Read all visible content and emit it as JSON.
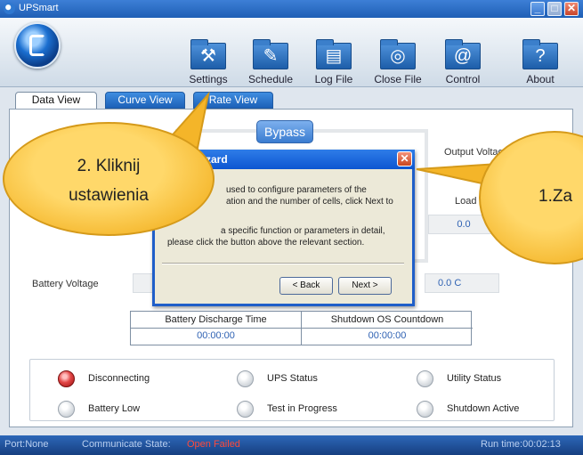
{
  "window": {
    "title": "UPSmart"
  },
  "toolbar": [
    {
      "label": "Settings",
      "icon": "hammer-icon",
      "glyph": "⚒"
    },
    {
      "label": "Schedule",
      "icon": "edit-icon",
      "glyph": "✎"
    },
    {
      "label": "Log File",
      "icon": "document-icon",
      "glyph": "▤"
    },
    {
      "label": "Close File",
      "icon": "disc-icon",
      "glyph": "◎"
    },
    {
      "label": "Control",
      "icon": "at-icon",
      "glyph": "@"
    },
    {
      "label": "About",
      "icon": "question-icon",
      "glyph": "?"
    }
  ],
  "tabs": [
    {
      "label": "Data View",
      "active": true
    },
    {
      "label": "Curve View",
      "active": false
    },
    {
      "label": "Rate View",
      "active": false
    }
  ],
  "main": {
    "bypass_label": "Bypass",
    "output_voltage_label": "Output Voltage",
    "load_label": "Load",
    "load_value": "0.0",
    "battery_voltage_label": "Battery Voltage",
    "temperature_value": "0.0 C",
    "battery_discharge_label": "Battery Discharge Time",
    "battery_discharge_value": "00:00:00",
    "shutdown_countdown_label": "Shutdown OS Countdown",
    "shutdown_countdown_value": "00:00:00"
  },
  "indicators": [
    {
      "label": "Disconnecting",
      "state": "red"
    },
    {
      "label": "UPS Status",
      "state": "off"
    },
    {
      "label": "Utility Status",
      "state": "off"
    },
    {
      "label": "Battery Low",
      "state": "off"
    },
    {
      "label": "Test in Progress",
      "state": "off"
    },
    {
      "label": "Shutdown Active",
      "state": "off"
    }
  ],
  "statusbar": {
    "port": "Port:None",
    "communicate_label": "Communicate State:",
    "communicate_value": "Open Failed",
    "run_time": "Run time:00:02:13"
  },
  "wizard": {
    "title": "zard",
    "line1": "used to configure parameters of the",
    "line2": "ation and the number of cells, click Next to",
    "line3": "a specific function or parameters in detail,",
    "line4": "please click the button above the relevant section.",
    "back_label": "< Back",
    "next_label": "Next >"
  },
  "callouts": {
    "left_line1": "2. Kliknij",
    "left_line2": "ustawienia",
    "right": "1.Za"
  },
  "colors": {
    "accent": "#1f5fb5",
    "failed": "#ff4a3a",
    "callout": "#f4b529"
  }
}
